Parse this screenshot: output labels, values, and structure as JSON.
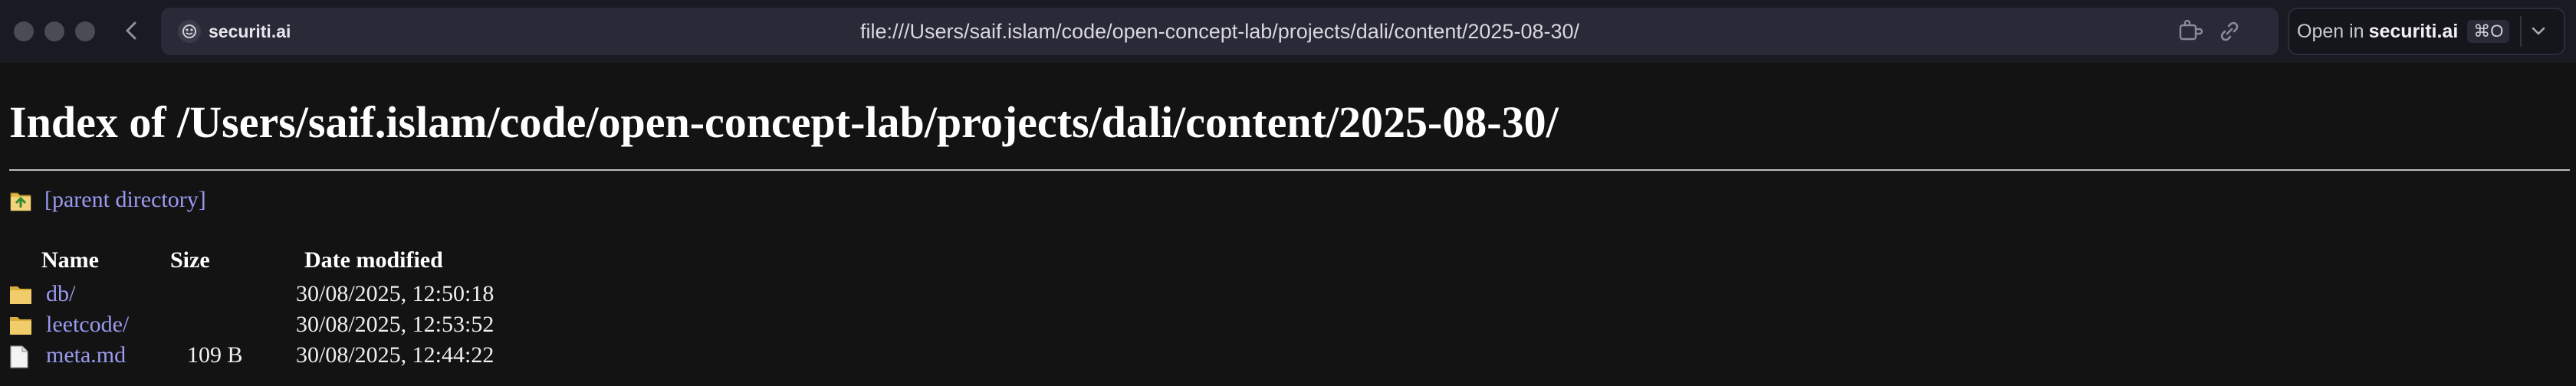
{
  "browser": {
    "site_badge": "securiti.ai",
    "url": "file:///Users/saif.islam/code/open-concept-lab/projects/dali/content/2025-08-30/",
    "open_in_label": "Open in",
    "open_in_brand": "securiti.ai",
    "open_in_shortcut": "⌘O",
    "icons": [
      "back-arrow-icon",
      "puzzle-extension-icon",
      "link-icon",
      "chevron-down-icon"
    ]
  },
  "page": {
    "title": "Index of /Users/saif.islam/code/open-concept-lab/projects/dali/content/2025-08-30/",
    "parent_link": "[parent directory]",
    "columns": {
      "name": "Name",
      "size": "Size",
      "date": "Date modified"
    },
    "rows": [
      {
        "name": "db/",
        "size": "",
        "date": "30/08/2025, 12:50:18",
        "icon": "folder-icon"
      },
      {
        "name": "leetcode/",
        "size": "",
        "date": "30/08/2025, 12:53:52",
        "icon": "folder-icon"
      },
      {
        "name": "meta.md",
        "size": "109 B",
        "date": "30/08/2025, 12:44:22",
        "icon": "file-icon"
      }
    ]
  },
  "colors": {
    "background": "#131313",
    "link": "#9a9af0",
    "text": "#ffffff",
    "folder": "#e6c35a"
  }
}
